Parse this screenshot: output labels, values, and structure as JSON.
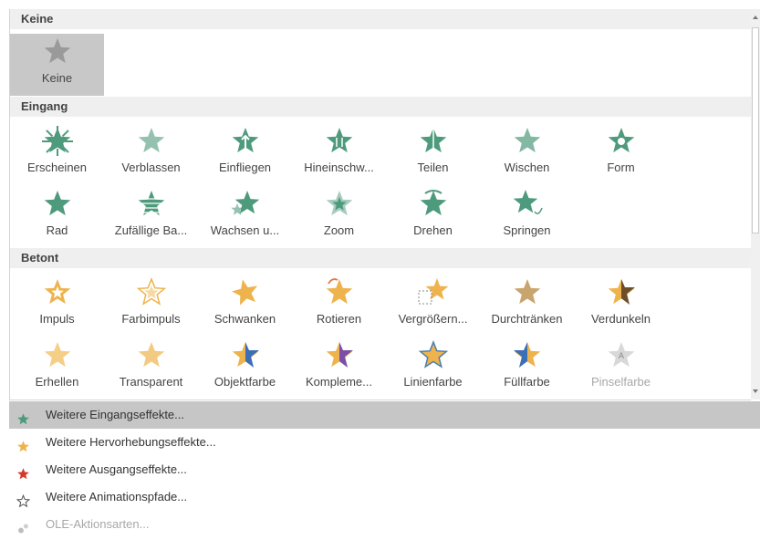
{
  "sections": {
    "none": {
      "title": "Keine",
      "items": [
        {
          "label": "Keine",
          "icon": "gray-star-icon"
        }
      ]
    },
    "entrance": {
      "title": "Eingang",
      "items": [
        {
          "label": "Erscheinen",
          "icon": "appear-star-icon"
        },
        {
          "label": "Verblassen",
          "icon": "fade-star-icon"
        },
        {
          "label": "Einfliegen",
          "icon": "fly-in-star-icon"
        },
        {
          "label": "Hineinschw...",
          "icon": "float-in-star-icon"
        },
        {
          "label": "Teilen",
          "icon": "split-star-icon"
        },
        {
          "label": "Wischen",
          "icon": "wipe-star-icon"
        },
        {
          "label": "Form",
          "icon": "shape-star-icon"
        },
        {
          "label": "Rad",
          "icon": "wheel-star-icon"
        },
        {
          "label": "Zufällige Ba...",
          "icon": "random-bars-star-icon"
        },
        {
          "label": "Wachsen u...",
          "icon": "grow-turn-star-icon"
        },
        {
          "label": "Zoom",
          "icon": "zoom-star-icon"
        },
        {
          "label": "Drehen",
          "icon": "swivel-star-icon"
        },
        {
          "label": "Springen",
          "icon": "bounce-star-icon"
        }
      ]
    },
    "emphasis": {
      "title": "Betont",
      "items": [
        {
          "label": "Impuls",
          "icon": "pulse-star-icon"
        },
        {
          "label": "Farbimpuls",
          "icon": "color-pulse-star-icon"
        },
        {
          "label": "Schwanken",
          "icon": "teeter-star-icon"
        },
        {
          "label": "Rotieren",
          "icon": "spin-star-icon"
        },
        {
          "label": "Vergrößern...",
          "icon": "grow-shrink-star-icon"
        },
        {
          "label": "Durchtränken",
          "icon": "desaturate-star-icon"
        },
        {
          "label": "Verdunkeln",
          "icon": "darken-star-icon"
        },
        {
          "label": "Erhellen",
          "icon": "lighten-star-icon"
        },
        {
          "label": "Transparent",
          "icon": "transparency-star-icon"
        },
        {
          "label": "Objektfarbe",
          "icon": "object-color-star-icon"
        },
        {
          "label": "Kompleme...",
          "icon": "complementary-star-icon"
        },
        {
          "label": "Linienfarbe",
          "icon": "line-color-star-icon"
        },
        {
          "label": "Füllfarbe",
          "icon": "fill-color-star-icon"
        },
        {
          "label": "Pinselfarbe",
          "icon": "brush-color-star-icon"
        }
      ]
    }
  },
  "menu": [
    {
      "label": "Weitere Eingangseffekte...",
      "icon": "green-star-icon"
    },
    {
      "label": "Weitere Hervorhebungseffekte...",
      "icon": "yellow-star-icon"
    },
    {
      "label": "Weitere Ausgangseffekte...",
      "icon": "red-star-icon"
    },
    {
      "label": "Weitere Animationspfade...",
      "icon": "outline-star-icon"
    },
    {
      "label": "OLE-Aktionsarten...",
      "icon": "gears-icon"
    }
  ],
  "colors": {
    "entrance": "#4e9a7c",
    "emphasis": "#eeb34c",
    "exit": "#d23a2a",
    "none": "#9a9a9a",
    "highlight": "#c6c6c6"
  }
}
